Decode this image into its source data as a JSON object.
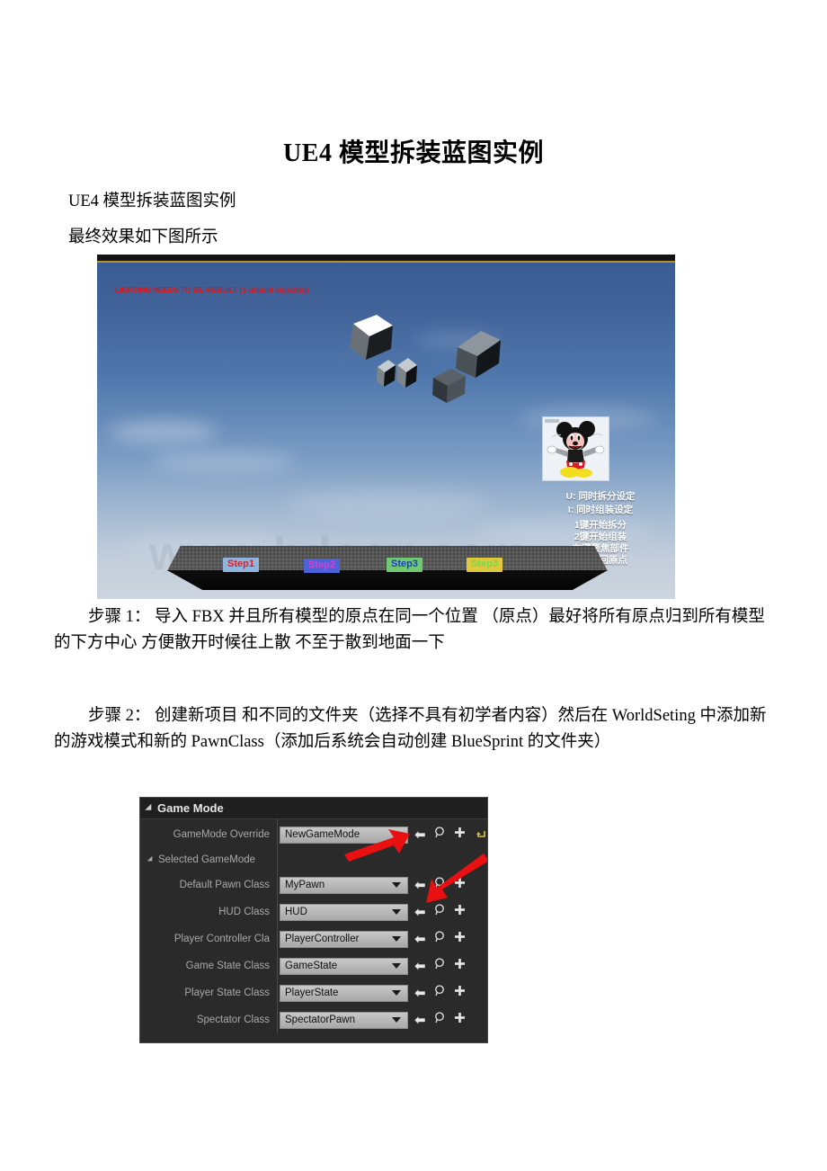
{
  "document": {
    "title": "UE4 模型拆装蓝图实例",
    "subtitle_1": "UE4 模型拆装蓝图实例",
    "subtitle_2": "最终效果如下图所示",
    "step1_paragraph": "步骤 1： 导入 FBX 并且所有模型的原点在同一个位置 （原点）最好将所有原点归到所有模型的下方中心 方便散开时候往上散 不至于散到地面一下",
    "step2_paragraph": "步骤 2： 创建新项目 和不同的文件夹（选择不具有初学者内容）然后在 WorldSeting 中添加新的游戏模式和新的 PawnClass（添加后系统会自动创建 BlueSprint 的文件夹）"
  },
  "game_screenshot": {
    "warning_text": "LIGHTING NEEDS TO BE REBUILT (1 unbuilt object(s))",
    "warning_color": "#e01414",
    "watermark": "www.bdocx.com",
    "hud": {
      "line1": "U: 同时拆分设定",
      "line2": "I: 同时组装设定",
      "line3": "1键开始拆分",
      "line4": "2键开始组装",
      "line5": "右键聚焦部件",
      "line6": "B键返回原点"
    },
    "step_buttons": [
      {
        "label": "Step1",
        "text_color": "#e81c1c",
        "bg_color": "#8fb4de"
      },
      {
        "label": "Step2",
        "text_color": "#e03cd0",
        "bg_color": "#4a63d8"
      },
      {
        "label": "Step3",
        "text_color": "#2038d8",
        "bg_color": "#6fca6f"
      },
      {
        "label": "Step3",
        "text_color": "#7ad84a",
        "bg_color": "#e0c83c"
      }
    ]
  },
  "game_mode_panel": {
    "header": "Game Mode",
    "override_label": "GameMode Override",
    "override_value": "NewGameMode",
    "selected_section": "Selected GameMode",
    "rows": [
      {
        "label": "Default Pawn Class",
        "value": "MyPawn"
      },
      {
        "label": "HUD Class",
        "value": "HUD"
      },
      {
        "label": "Player Controller Cla",
        "value": "PlayerController"
      },
      {
        "label": "Game State Class",
        "value": "GameState"
      },
      {
        "label": "Player State Class",
        "value": "PlayerState"
      },
      {
        "label": "Spectator Class",
        "value": "SpectatorPawn"
      }
    ],
    "icons": {
      "back": "back-arrow-icon",
      "browse": "magnifier-icon",
      "add": "plus-icon",
      "reset": "reset-arrow-icon"
    },
    "accent_color": "#d8c83c",
    "annotation_arrow_color": "#e81010"
  }
}
